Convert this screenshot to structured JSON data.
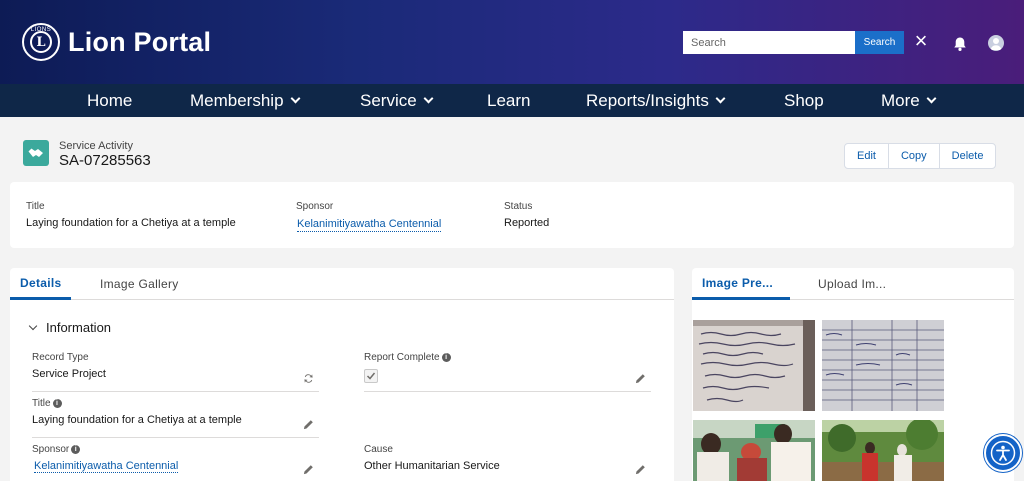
{
  "header": {
    "logo_emblem_text": "LIONS",
    "logo_letter": "L",
    "app_title": "Lion Portal",
    "search_placeholder": "Search",
    "search_button": "Search"
  },
  "nav": {
    "items": [
      {
        "label": "Home",
        "has_menu": false
      },
      {
        "label": "Membership",
        "has_menu": true
      },
      {
        "label": "Service",
        "has_menu": true
      },
      {
        "label": "Learn",
        "has_menu": false
      },
      {
        "label": "Reports/Insights",
        "has_menu": true
      },
      {
        "label": "Shop",
        "has_menu": false
      },
      {
        "label": "More",
        "has_menu": true
      }
    ]
  },
  "record": {
    "object_type": "Service Activity",
    "record_id": "SA-07285563",
    "actions": [
      "Edit",
      "Copy",
      "Delete"
    ],
    "icon": "handshake-icon",
    "icon_color": "#3ba99c"
  },
  "highlights": {
    "title_label": "Title",
    "title_value": "Laying foundation for a Chetiya at a temple",
    "sponsor_label": "Sponsor",
    "sponsor_value": "Kelanimitiyawatha Centennial",
    "status_label": "Status",
    "status_value": "Reported"
  },
  "details": {
    "tabs": [
      "Details",
      "Image Gallery"
    ],
    "active_tab": "Details",
    "section_title": "Information",
    "fields": {
      "record_type_label": "Record Type",
      "record_type_value": "Service Project",
      "report_complete_label": "Report Complete",
      "report_complete_checked": true,
      "title_label": "Title",
      "title_value": "Laying foundation for a Chetiya at a temple",
      "sponsor_label": "Sponsor",
      "sponsor_value": "Kelanimitiyawatha Centennial",
      "cause_label": "Cause",
      "cause_value": "Other Humanitarian Service"
    }
  },
  "images": {
    "tabs": [
      "Image Pre...",
      "Upload Im..."
    ],
    "active_tab": "Image Pre..."
  },
  "colors": {
    "brand_blue": "#0b5cab",
    "nav_bg": "#0f2748",
    "search_button": "#1b6fc9"
  }
}
